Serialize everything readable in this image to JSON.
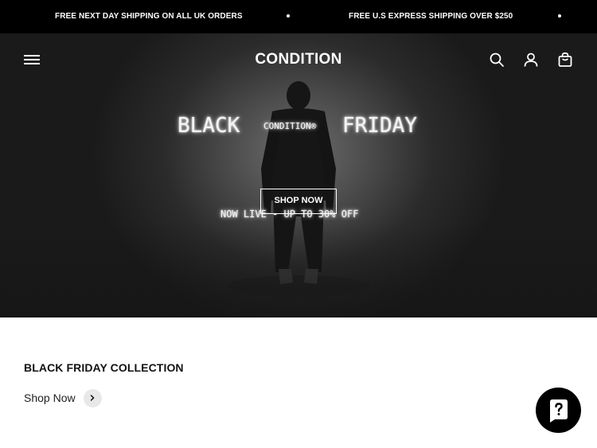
{
  "announcement": {
    "messages": [
      "FREE NEXT DAY SHIPPING ON ALL UK ORDERS",
      "FREE U.S EXPRESS SHIPPING OVER $250"
    ]
  },
  "header": {
    "logo": "CONDITION",
    "icons": [
      "menu-icon",
      "search-icon",
      "account-icon",
      "cart-icon"
    ]
  },
  "hero": {
    "title_left": "BLACK",
    "title_mid": "CONDITION®",
    "title_right": "FRIDAY",
    "cta_label": "SHOP NOW",
    "subtitle": "NOW LIVE - UP TO 30% OFF"
  },
  "collection": {
    "title": "BLACK FRIDAY COLLECTION",
    "link_label": "Shop Now"
  },
  "chat": {
    "icon": "chat-question-icon"
  }
}
